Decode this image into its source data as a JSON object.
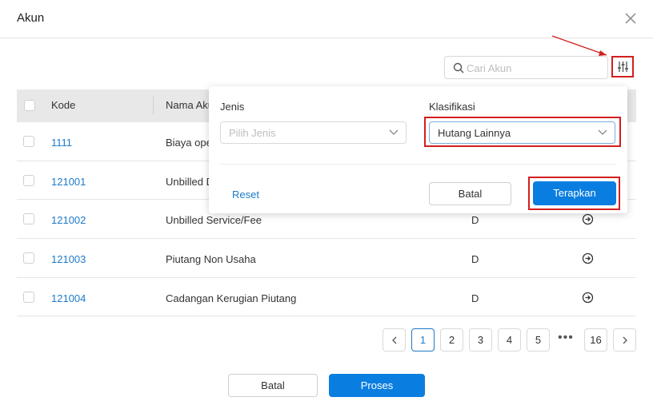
{
  "modal": {
    "title": "Akun"
  },
  "search": {
    "placeholder": "Cari Akun"
  },
  "table": {
    "columns": [
      "Kode",
      "Nama Akun"
    ],
    "rows": [
      {
        "code": "1111",
        "name": "Biaya ope",
        "dc": ""
      },
      {
        "code": "121001",
        "name": "Unbilled D",
        "dc": ""
      },
      {
        "code": "121002",
        "name": "Unbilled Service/Fee",
        "dc": "D"
      },
      {
        "code": "121003",
        "name": "Piutang Non Usaha",
        "dc": "D"
      },
      {
        "code": "121004",
        "name": "Cadangan Kerugian Piutang",
        "dc": "D"
      }
    ]
  },
  "filter": {
    "jenis_label": "Jenis",
    "jenis_placeholder": "Pilih Jenis",
    "klasifikasi_label": "Klasifikasi",
    "klasifikasi_value": "Hutang Lainnya",
    "reset": "Reset",
    "cancel": "Batal",
    "apply": "Terapkan"
  },
  "pagination": {
    "pages": [
      "1",
      "2",
      "3",
      "4",
      "5"
    ],
    "ellipsis": "•••",
    "last": "16",
    "current": "1"
  },
  "footer": {
    "cancel": "Batal",
    "process": "Proses"
  },
  "colors": {
    "accent": "#0a7ee0",
    "link": "#1e7ac8",
    "highlight": "#d21f1f"
  },
  "icons": [
    "close-icon",
    "search-icon",
    "filter-sliders-icon",
    "chevron-down-icon",
    "arrow-circle-right-icon",
    "chevron-left-icon",
    "chevron-right-icon"
  ]
}
